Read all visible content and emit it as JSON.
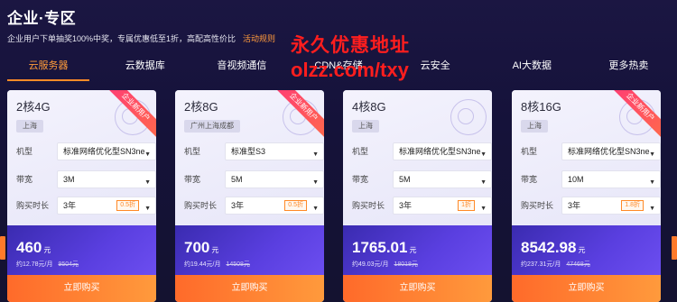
{
  "header": {
    "title": "企业·专区",
    "subtitle": "企业用户下单抽奖100%中奖，专属优惠低至1折，高配高性价比",
    "rules_link": "活动规则"
  },
  "promo": {
    "line1": "永久优惠地址",
    "line2": "olzz.com/txy"
  },
  "tabs": [
    {
      "label": "云服务器",
      "active": true
    },
    {
      "label": "云数据库"
    },
    {
      "label": "音视频通信"
    },
    {
      "label": "CDN&存储"
    },
    {
      "label": "云安全"
    },
    {
      "label": "AI大数据"
    },
    {
      "label": "更多热卖"
    }
  ],
  "labels": {
    "model": "机型",
    "bandwidth": "带宽",
    "duration": "购买时长",
    "buy": "立即购买",
    "ribbon": "企业新用户",
    "price_unit": "元"
  },
  "cards": [
    {
      "spec": "2核4G",
      "region": "上海",
      "model": "标准网络优化型SN3ne",
      "bandwidth": "3M",
      "duration": "3年",
      "discount": "0.5折",
      "price": "460",
      "monthly": "约12.78元/月",
      "original": "9504元"
    },
    {
      "spec": "2核8G",
      "region": "广州上海成都",
      "model": "标准型S3",
      "bandwidth": "5M",
      "duration": "3年",
      "discount": "0.5折",
      "price": "700",
      "monthly": "约19.44元/月",
      "original": "14508元"
    },
    {
      "spec": "4核8G",
      "region": "上海",
      "model": "标准网络优化型SN3ne",
      "bandwidth": "5M",
      "duration": "3年",
      "discount": "1折",
      "price": "1765.01",
      "monthly": "约49.03元/月",
      "original": "18018元"
    },
    {
      "spec": "8核16G",
      "region": "上海",
      "model": "标准网络优化型SN3ne",
      "bandwidth": "10M",
      "duration": "3年",
      "discount": "1.8折",
      "price": "8542.98",
      "monthly": "约237.31元/月",
      "original": "47468元"
    }
  ],
  "colors": {
    "accent": "#ff8a28",
    "promo_red": "#ff1e1e",
    "card_bottom": "#5a3fe0"
  }
}
